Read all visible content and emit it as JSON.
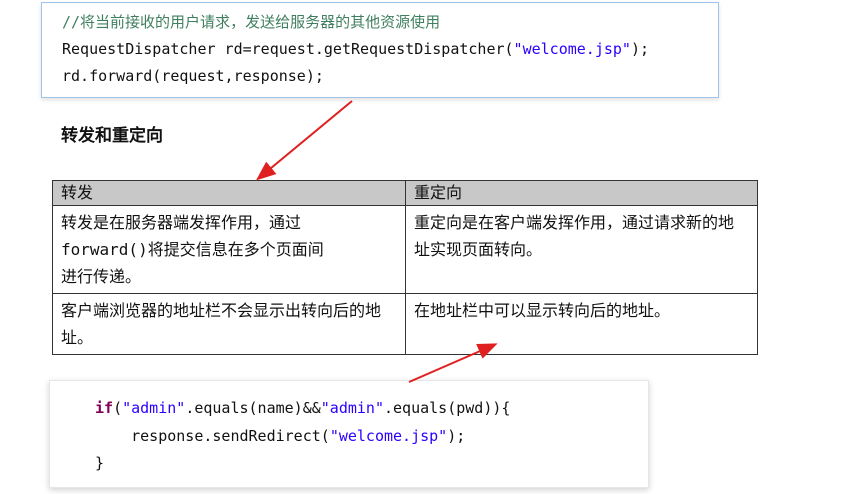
{
  "code_top": {
    "comment": "//将当前接收的用户请求，发送给服务器的其他资源使用",
    "line2_pre": "RequestDispatcher rd=request.getRequestDispatcher(",
    "line2_str": "\"welcome.jsp\"",
    "line2_post": ");",
    "line3": "rd.forward(request,response);"
  },
  "heading": "转发和重定向",
  "table": {
    "headers": [
      "转发",
      "重定向"
    ],
    "row1": {
      "c1_line1": "转发是在服务器端发挥作用，通过",
      "c1_code": "forward()",
      "c1_line2": "将提交信息在多个页面间",
      "c1_line3": "进行传递。",
      "c2": "重定向是在客户端发挥作用，通过请求新的地址实现页面转向。"
    },
    "row2": {
      "c1": "客户端浏览器的地址栏不会显示出转向后的地址。",
      "c2": "在地址栏中可以显示转向后的地址。"
    }
  },
  "code_bottom": {
    "kw_if": "if",
    "l1_a": "(",
    "l1_s1": "\"admin\"",
    "l1_b": ".equals(name)&&",
    "l1_s2": "\"admin\"",
    "l1_c": ".equals(pwd)){",
    "l2_a": "    response.sendRedirect(",
    "l2_s": "\"welcome.jsp\"",
    "l2_b": ");",
    "l3": "}"
  },
  "colors": {
    "arrow": "#e02020",
    "border_blue": "#9fc4e8",
    "header_bg": "#c8c8c8"
  }
}
